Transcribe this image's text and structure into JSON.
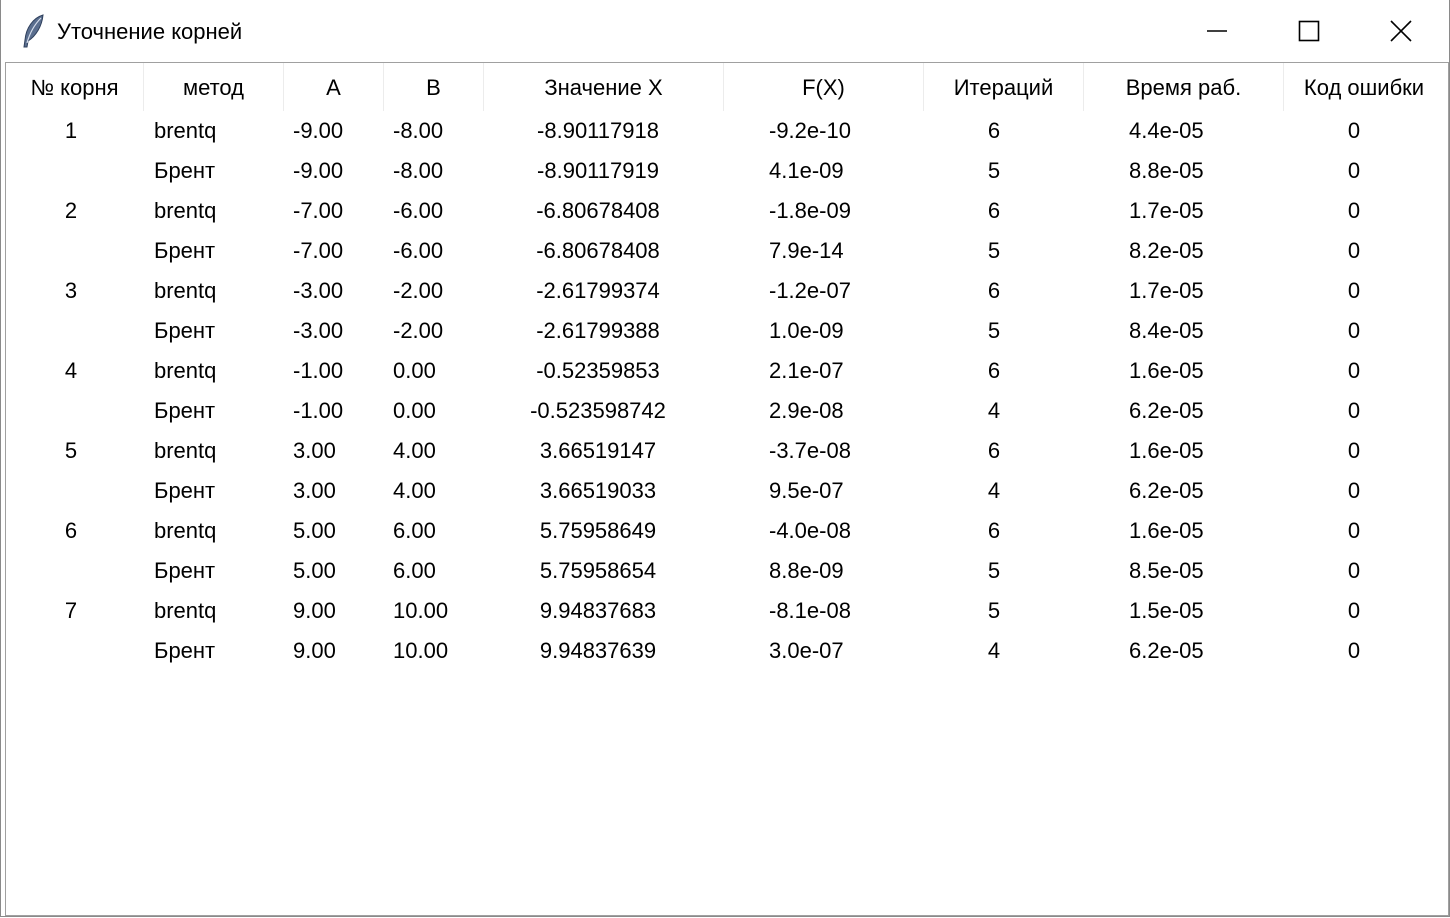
{
  "window": {
    "title": "Уточнение корней",
    "icon": "feather-icon"
  },
  "table": {
    "columns": [
      "№ корня",
      "метод",
      "A",
      "B",
      "Значение X",
      "F(X)",
      "Итераций",
      "Время раб.",
      "Код ошибки"
    ],
    "rows": [
      [
        "1",
        "brentq",
        "-9.00",
        "-8.00",
        "-8.90117918",
        "-9.2e-10",
        "6",
        "4.4e-05",
        "0"
      ],
      [
        "",
        "Брент",
        "-9.00",
        "-8.00",
        "-8.90117919",
        "4.1e-09",
        "5",
        "8.8e-05",
        "0"
      ],
      [
        "2",
        "brentq",
        "-7.00",
        "-6.00",
        "-6.80678408",
        "-1.8e-09",
        "6",
        "1.7e-05",
        "0"
      ],
      [
        "",
        "Брент",
        "-7.00",
        "-6.00",
        "-6.80678408",
        "7.9e-14",
        "5",
        "8.2e-05",
        "0"
      ],
      [
        "3",
        "brentq",
        "-3.00",
        "-2.00",
        "-2.61799374",
        "-1.2e-07",
        "6",
        "1.7e-05",
        "0"
      ],
      [
        "",
        "Брент",
        "-3.00",
        "-2.00",
        "-2.61799388",
        "1.0e-09",
        "5",
        "8.4e-05",
        "0"
      ],
      [
        "4",
        "brentq",
        "-1.00",
        "0.00",
        "-0.52359853",
        "2.1e-07",
        "6",
        "1.6e-05",
        "0"
      ],
      [
        "",
        "Брент",
        "-1.00",
        "0.00",
        "-0.523598742",
        "2.9e-08",
        "4",
        "6.2e-05",
        "0"
      ],
      [
        "5",
        "brentq",
        "3.00",
        "4.00",
        "3.66519147",
        "-3.7e-08",
        "6",
        "1.6e-05",
        "0"
      ],
      [
        "",
        "Брент",
        "3.00",
        "4.00",
        "3.66519033",
        "9.5e-07",
        "4",
        "6.2e-05",
        "0"
      ],
      [
        "6",
        "brentq",
        "5.00",
        "6.00",
        "5.75958649",
        "-4.0e-08",
        "6",
        "1.6e-05",
        "0"
      ],
      [
        "",
        "Брент",
        "5.00",
        "6.00",
        "5.75958654",
        "8.8e-09",
        "5",
        "8.5e-05",
        "0"
      ],
      [
        "7",
        "brentq",
        "9.00",
        "10.00",
        "9.94837683",
        "-8.1e-08",
        "5",
        "1.5e-05",
        "0"
      ],
      [
        "",
        "Брент",
        "9.00",
        "10.00",
        "9.94837639",
        "3.0e-07",
        "4",
        "6.2e-05",
        "0"
      ]
    ]
  }
}
